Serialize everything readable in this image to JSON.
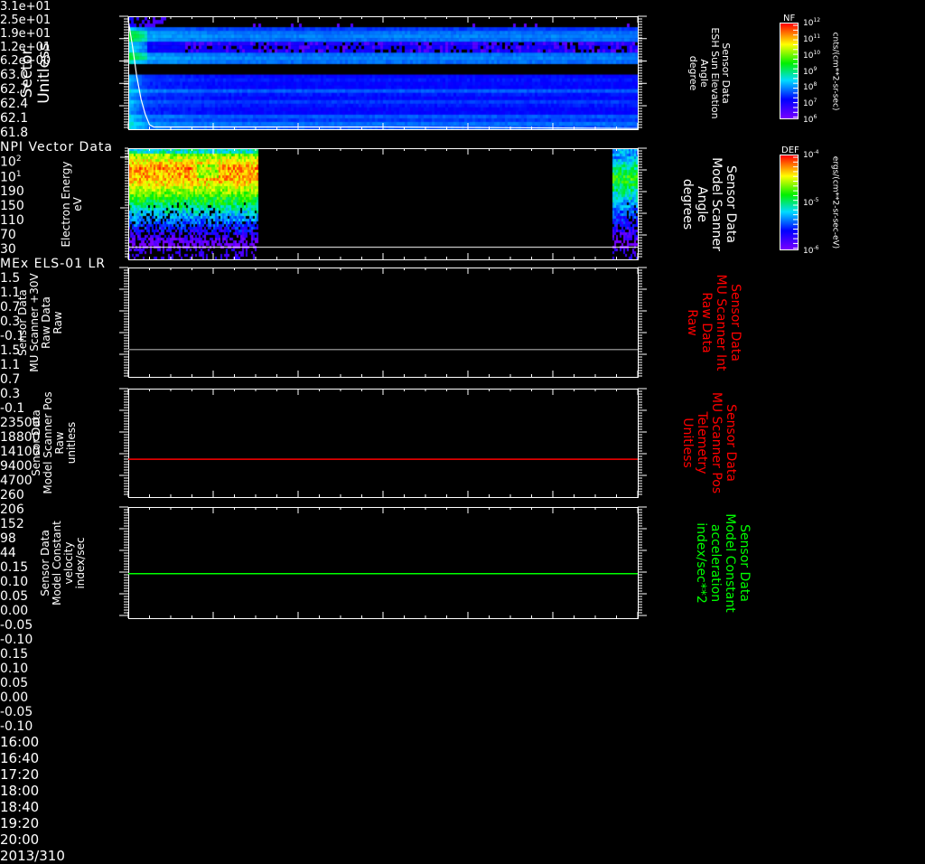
{
  "chart_data": [
    {
      "type": "heatmap",
      "title": "NPI Vector Data",
      "ylabel": [
        "Sector",
        "Unitless"
      ],
      "yticks": [
        "3.1e+01",
        "2.5e+01",
        "1.9e+01",
        "1.2e+01",
        "6.2e+00"
      ],
      "ylim": [
        0,
        31
      ],
      "y2label": [
        "Sensor Data",
        "ESH Sun Elevation",
        "Angle",
        "degree"
      ],
      "y2ticks": [
        "63.0",
        "62.7",
        "62.4",
        "62.1",
        "61.8"
      ],
      "y2lim": [
        61.5,
        63.0
      ],
      "line_series": {
        "name": "ESH Sun Elevation Angle",
        "color": "#ffffff",
        "x_min": [
          0,
          2,
          4,
          6,
          8,
          10,
          12,
          30,
          60,
          120,
          180,
          240
        ],
        "y": [
          62.95,
          62.6,
          62.2,
          61.9,
          61.7,
          61.56,
          61.53,
          61.53,
          61.53,
          61.53,
          61.52,
          61.51
        ]
      },
      "colorbar": {
        "title": "NF",
        "ticks": [
          "10^12",
          "10^11",
          "10^10",
          "10^9",
          "10^8",
          "10^7",
          "10^6"
        ],
        "label": "cnts/(cm**2-sr-sec)"
      }
    },
    {
      "type": "heatmap",
      "title": "MEx ELS-01 LR",
      "ylabel": [
        "Electron Energy",
        "eV"
      ],
      "yticks": [
        "10^2",
        "10^1"
      ],
      "y2label": [
        "Sensor Data",
        "Model Scanner",
        "Angle",
        "degrees"
      ],
      "y2ticks": [
        "190",
        "150",
        "110",
        "70",
        "30"
      ],
      "y2lim": [
        -10,
        190
      ],
      "data_intervals_min": [
        [
          0,
          62
        ],
        [
          236,
          240
        ]
      ],
      "colorbar": {
        "title": "DEF",
        "ticks": [
          "10^-4",
          "10^-5",
          "10^-6"
        ],
        "label": "ergs/(cm**2-sr-sec-eV)"
      }
    },
    {
      "type": "line",
      "ylabel": [
        "Sensor Data",
        "MU Scanner +30V",
        "Raw Data",
        "Raw"
      ],
      "yticks": [
        "1.5",
        "1.1",
        "0.7",
        "0.3",
        "-0.1"
      ],
      "ylim": [
        -0.5,
        1.5
      ],
      "y2label": [
        "Sensor Data",
        "MU Scanner Int",
        "Raw Data",
        "Raw"
      ],
      "y2ticks": [
        "1.5",
        "1.1",
        "0.7",
        "0.3",
        "-0.1"
      ],
      "series": [
        {
          "name": "MU Scanner Int",
          "color": "#808080",
          "value": 0.0
        }
      ]
    },
    {
      "type": "line",
      "ylabel": [
        "Sensor Data",
        "Model Scanner Pos",
        "Raw",
        "unitless"
      ],
      "yticks": [
        "23500",
        "18800",
        "14100",
        "9400",
        "4700"
      ],
      "ylim": [
        0,
        23500
      ],
      "y2label": [
        "Sensor Data",
        "MU Scanner Pos",
        "Telemetry",
        "Unitless"
      ],
      "y2ticks": [
        "260",
        "206",
        "152",
        "98",
        "44"
      ],
      "series": [
        {
          "name": "MU Scanner Pos Telemetry",
          "color": "#ff0000",
          "value": 8200
        }
      ]
    },
    {
      "type": "line",
      "ylabel": [
        "Sensor Data",
        "Model Constant",
        "velocity",
        "index/sec"
      ],
      "yticks": [
        "0.15",
        "0.10",
        "0.05",
        "0.00",
        "-0.05",
        "-0.10"
      ],
      "ylim": [
        -0.1,
        0.15
      ],
      "y2label": [
        "Sensor Data",
        "Model Constant",
        "acceleration",
        "index/sec**2"
      ],
      "y2ticks": [
        "0.15",
        "0.10",
        "0.05",
        "0.00",
        "-0.05",
        "-0.10"
      ],
      "series": [
        {
          "name": "Model Constant acceleration",
          "color": "#00ff00",
          "value": 0.0
        }
      ]
    }
  ],
  "xaxis": {
    "date": "2013/310",
    "ticks": [
      "16:00",
      "16:40",
      "17:20",
      "18:00",
      "18:40",
      "19:20",
      "20:00"
    ],
    "range_min": [
      0,
      240
    ]
  },
  "colors": {
    "red_label": "#ff0000",
    "green_label": "#00ff00"
  }
}
